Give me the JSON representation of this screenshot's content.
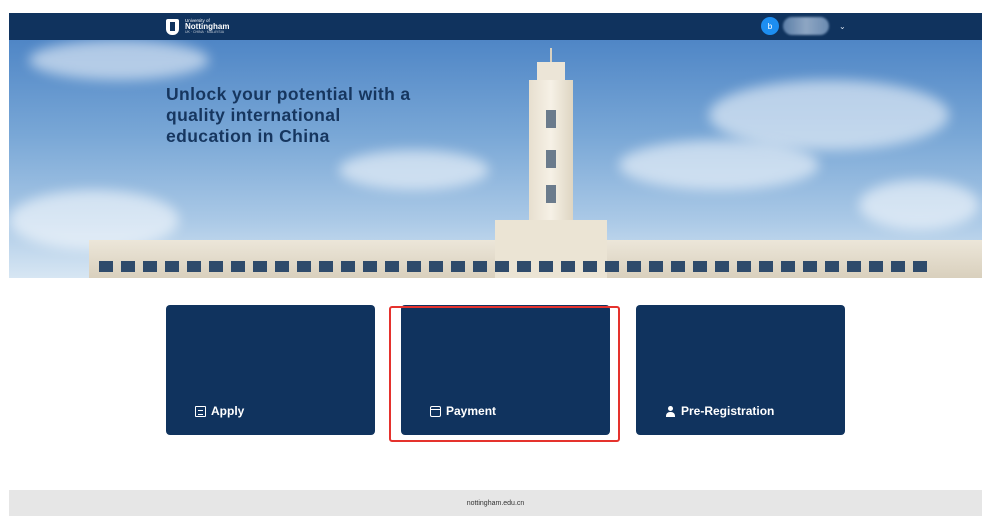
{
  "header": {
    "logo": {
      "line1": "University of",
      "line2": "Nottingham",
      "line3": "UK · CHINA · MALAYSIA"
    },
    "user": {
      "avatar_initial": "b",
      "menu_icon": "chevron-down-icon"
    }
  },
  "hero": {
    "headline": "Unlock your potential with a quality international education in China"
  },
  "cards": [
    {
      "label": "Apply",
      "icon": "document-icon"
    },
    {
      "label": "Payment",
      "icon": "credit-card-icon",
      "highlighted": true
    },
    {
      "label": "Pre-Registration",
      "icon": "person-icon"
    }
  ],
  "footer": {
    "link": "nottingham.edu.cn"
  },
  "colors": {
    "navy": "#10335e",
    "highlight": "#e5322d",
    "avatar": "#1d8ef1",
    "footer_bg": "#e6e6e6"
  }
}
